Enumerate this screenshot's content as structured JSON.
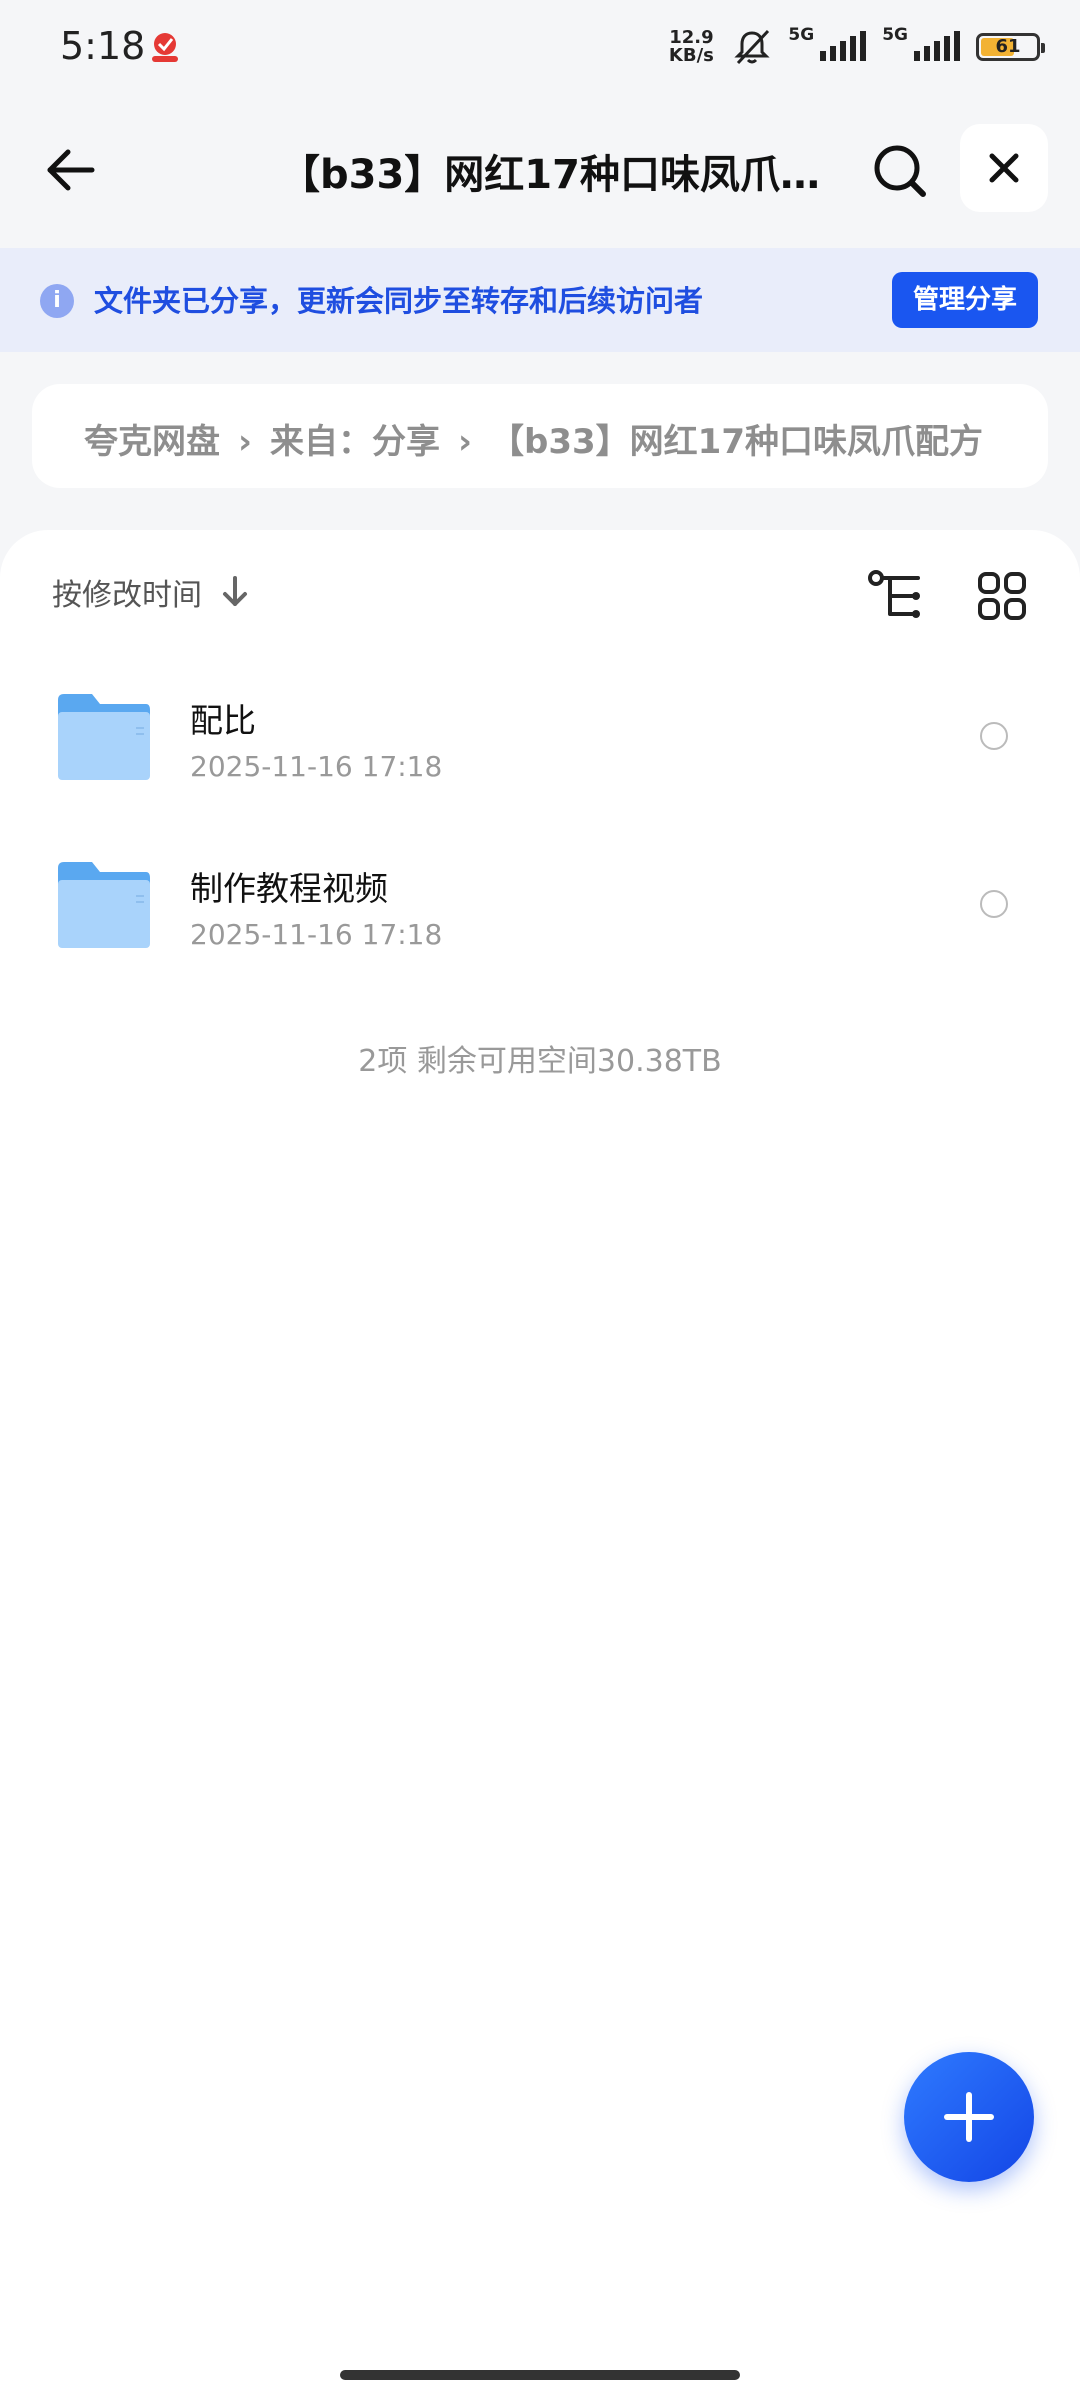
{
  "status_bar": {
    "time": "5:18",
    "net_speed_value": "12.9",
    "net_speed_unit": "KB/s",
    "signal_1": "5G",
    "signal_2": "5G",
    "battery_level": "61",
    "battery_fraction": 0.61,
    "battery_color": "#f2b233"
  },
  "header": {
    "title": "【b33】网红17种口味凤爪…",
    "back_icon": "arrow-left-icon",
    "search_icon": "search-icon",
    "close_icon": "close-icon"
  },
  "share_banner": {
    "text": "文件夹已分享，更新会同步至转存和后续访问者",
    "button_label": "管理分享",
    "info_icon_glyph": "i",
    "accent_color": "#1a56f0"
  },
  "breadcrumb": {
    "items": [
      "夸克网盘",
      "来自：分享",
      "【b33】网红17种口味凤爪配方"
    ],
    "separator": "›"
  },
  "list": {
    "sort_label": "按修改时间",
    "items": [
      {
        "name": "配比",
        "date": "2025-11-16 17:18"
      },
      {
        "name": "制作教程视频",
        "date": "2025-11-16 17:18"
      }
    ],
    "summary": "2项 剩余可用空间30.38TB"
  },
  "fab": {
    "icon": "plus-icon"
  }
}
